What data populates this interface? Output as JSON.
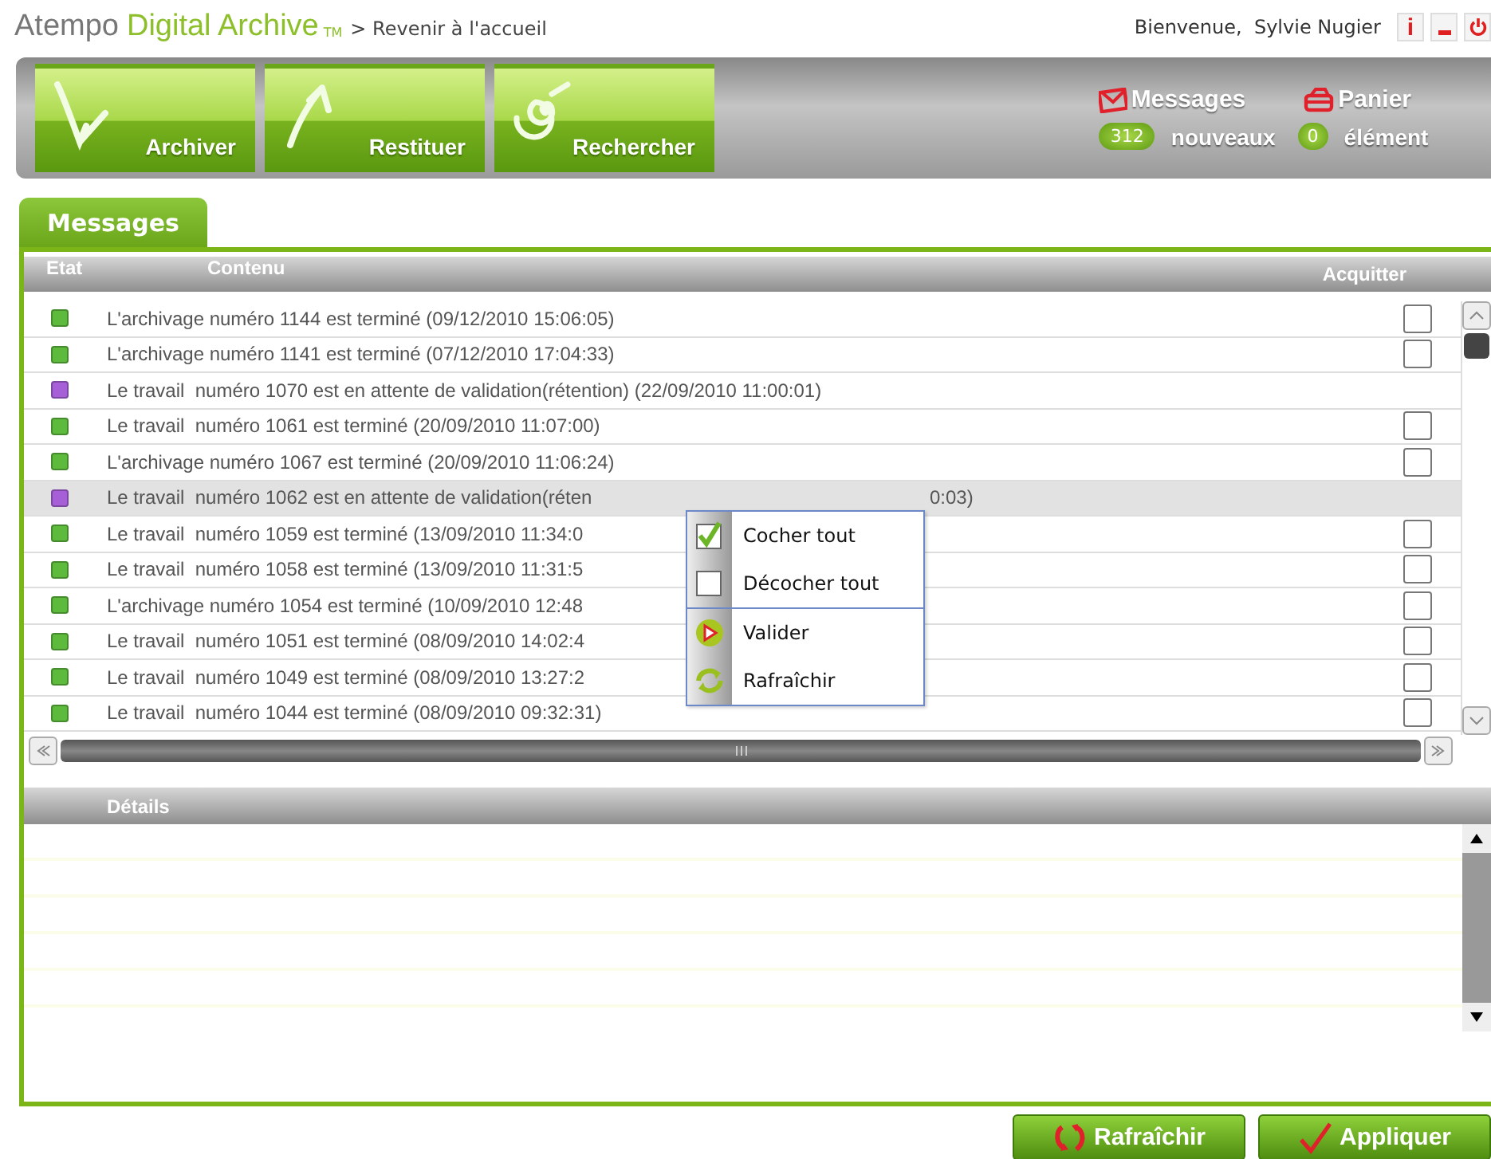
{
  "header": {
    "logo_brand": "Atempo",
    "logo_product": "Digital Archive",
    "logo_mark": "TM",
    "home_link": "> Revenir à l'accueil",
    "welcome": "Bienvenue,  Sylvie Nugier",
    "info_label": "i"
  },
  "toolbar": {
    "buttons": [
      {
        "kind": "archive",
        "label": "Archiver"
      },
      {
        "kind": "restore",
        "label": "Restituer"
      },
      {
        "kind": "search",
        "label": "Rechercher"
      }
    ],
    "messages": {
      "label": "Messages",
      "count": "312",
      "count_label": "nouveaux"
    },
    "basket": {
      "label": "Panier",
      "count": "0",
      "count_label": "élément"
    }
  },
  "tabs": [
    {
      "label": "Messages",
      "selected": true
    }
  ],
  "table": {
    "columns": [
      "Etat",
      "Contenu",
      "Acquitter"
    ],
    "rows": [
      {
        "color": "#5dba3c",
        "text": "L'archivage numéro 1144 est terminé (09/12/2010 15:06:05)",
        "checked": false,
        "selected": false
      },
      {
        "color": "#5dba3c",
        "text": "L'archivage numéro 1141 est terminé (07/12/2010 17:04:33)",
        "checked": false,
        "selected": false
      },
      {
        "color": "#a65fd6",
        "text": "Le travail  numéro 1070 est en attente de validation(rétention) (22/09/2010 11:00:01)",
        "selected": false
      },
      {
        "color": "#5dba3c",
        "text": "Le travail  numéro 1061 est terminé (20/09/2010 11:07:00)",
        "checked": false,
        "selected": false
      },
      {
        "color": "#5dba3c",
        "text": "L'archivage numéro 1067 est terminé (20/09/2010 11:06:24)",
        "checked": false,
        "selected": false
      },
      {
        "color": "#a65fd6",
        "text": "Le travail  numéro 1062 est en attente de validation(réten",
        "text_tail": "0:03)",
        "selected": true
      },
      {
        "color": "#5dba3c",
        "text": "Le travail  numéro 1059 est terminé (13/09/2010 11:34:0",
        "checked": false,
        "selected": false
      },
      {
        "color": "#5dba3c",
        "text": "Le travail  numéro 1058 est terminé (13/09/2010 11:31:5",
        "checked": false,
        "selected": false
      },
      {
        "color": "#5dba3c",
        "text": "L'archivage numéro 1054 est terminé (10/09/2010 12:48",
        "checked": false,
        "selected": false
      },
      {
        "color": "#5dba3c",
        "text": "Le travail  numéro 1051 est terminé (08/09/2010 14:02:4",
        "checked": false,
        "selected": false
      },
      {
        "color": "#5dba3c",
        "text": "Le travail  numéro 1049 est terminé (08/09/2010 13:27:2",
        "checked": false,
        "selected": false
      },
      {
        "color": "#5dba3c",
        "text": "Le travail  numéro 1044 est terminé (08/09/2010 09:32:31)",
        "checked": false,
        "selected": false
      }
    ]
  },
  "context_menu": {
    "items": [
      {
        "kind": "check",
        "label": "Cocher tout",
        "separator_before": false
      },
      {
        "kind": "uncheck",
        "label": "Décocher tout",
        "separator_before": false
      },
      {
        "kind": "validate",
        "label": "Valider",
        "separator_before": true
      },
      {
        "kind": "refresh",
        "label": "Rafraîchir",
        "separator_before": false
      }
    ]
  },
  "details": {
    "title": "Détails"
  },
  "footer_buttons": [
    {
      "kind": "refresh",
      "label": "Rafraîchir"
    },
    {
      "kind": "apply",
      "label": "Appliquer"
    }
  ]
}
